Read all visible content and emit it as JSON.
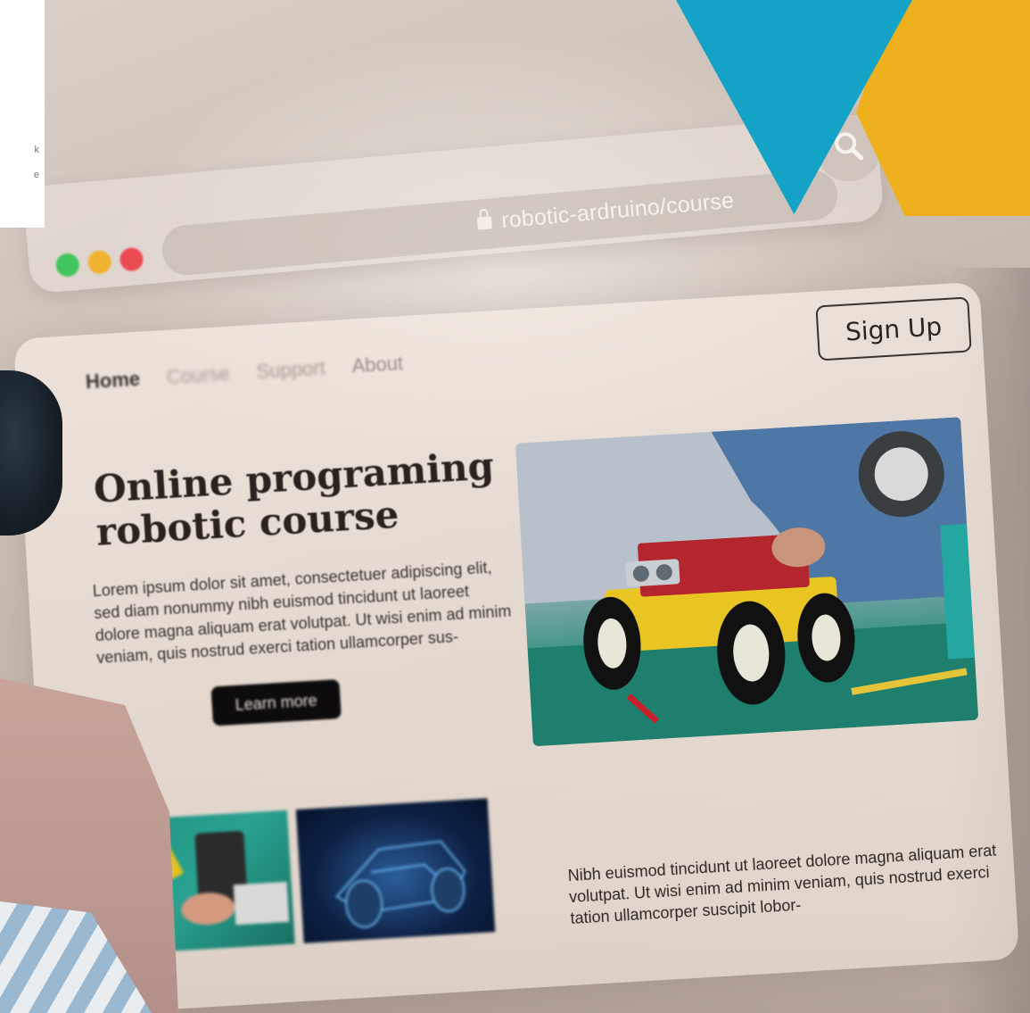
{
  "corner_card": {
    "line_1": "k",
    "line_2": "e"
  },
  "browser": {
    "url": "robotic-ardruino/course",
    "icons": [
      "lock-icon",
      "search-icon"
    ],
    "dot_colors": [
      "#43c55d",
      "#f0b330",
      "#ec4a52"
    ]
  },
  "nav": {
    "home": "Home",
    "course": "Course",
    "support": "Support",
    "about": "About",
    "signup": "Sign Up"
  },
  "hero": {
    "title_line_1": "Online programing",
    "title_line_2": "robotic course",
    "body": "Lorem ipsum dolor sit amet, consectetuer adipiscing elit, sed diam nonummy nibh euismod tincidunt ut laoreet dolore magna aliquam erat volutpat. Ut wisi enim ad minim veniam, quis nostrud exerci tation ullamcorper sus-",
    "cta": "Learn more"
  },
  "footer": {
    "text": "Nibh euismod tincidunt ut laoreet dolore magna aliquam erat volutpat. Ut wisi enim ad minim veniam, quis nostrud exerci tation ullamcorper suscipit lobor-"
  },
  "colors": {
    "accent_blue": "#14a2c6",
    "accent_yellow": "#eeb11d"
  }
}
